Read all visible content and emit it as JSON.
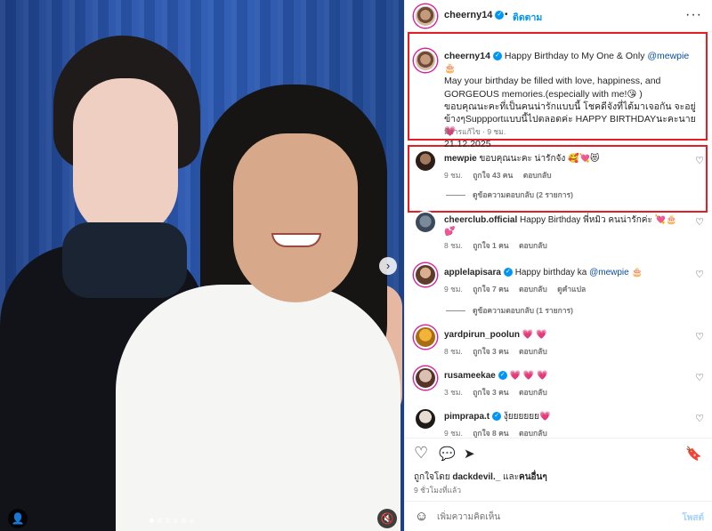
{
  "photo": {
    "next_icon": "›",
    "tag_icon": "👤",
    "mute_icon": "🔇",
    "carousel_dots": 6,
    "active_dot": 0
  },
  "header": {
    "username": "cheerny14",
    "separator": "•",
    "follow_label": "ติดตาม",
    "more_icon": "···"
  },
  "caption": {
    "username": "cheerny14",
    "line1_prefix": "Happy Birthday to My One & Only ",
    "mention": "@mewpie",
    "line1_suffix": " 🎂",
    "line2": "May your birthday be filled with love, happiness, and GORGEOUS memories.(especially with me!😘 )",
    "line3": "ขอบคุณนะคะที่เป็นคนน่ารักแบบนี้ โชคดีจังที่ได้มาเจอกัน จะอยู่ข้างๆSuppportแบบนี้ไปตลอดค่ะ HAPPY BIRTHDAYนะคะนาย💗",
    "line4": "21.12.2025",
    "meta": "มีการแก้ไข · 9 ชม."
  },
  "comments": [
    {
      "username": "mewpie",
      "verified": false,
      "text": "ขอบคุณนะคะ น่ารักจัง 🥰💘😻",
      "time": "9 ชม.",
      "likes": "ถูกใจ 43 คน",
      "reply": "ตอบกลับ",
      "translate": "",
      "replies_label": "ดูข้อความตอบกลับ (2 รายการ)"
    },
    {
      "username": "cheerclub.official",
      "verified": false,
      "text": "Happy Birthday พี่หมิว คนน่ารักค่ะ 💘🎂💕",
      "time": "8 ชม.",
      "likes": "ถูกใจ 1 คน",
      "reply": "ตอบกลับ",
      "translate": "",
      "replies_label": ""
    },
    {
      "username": "applelapisara",
      "verified": true,
      "text_prefix": "Happy birthday ka ",
      "mention": "@mewpie",
      "text_suffix": " 🎂",
      "time": "9 ชม.",
      "likes": "ถูกใจ 7 คน",
      "reply": "ตอบกลับ",
      "translate": "ดูคำแปล",
      "replies_label": "ดูข้อความตอบกลับ (1 รายการ)"
    },
    {
      "username": "yardpirun_poolun",
      "verified": false,
      "text": "💗 💗",
      "time": "8 ชม.",
      "likes": "ถูกใจ 3 คน",
      "reply": "ตอบกลับ",
      "translate": "",
      "replies_label": ""
    },
    {
      "username": "rusameekae",
      "verified": true,
      "text": "💗 💗 💗",
      "time": "3 ชม.",
      "likes": "ถูกใจ 3 คน",
      "reply": "ตอบกลับ",
      "translate": "",
      "replies_label": ""
    },
    {
      "username": "pimprapa.t",
      "verified": true,
      "text": "งุ้ยยยยยย💗",
      "time": "9 ชม.",
      "likes": "ถูกใจ 8 คน",
      "reply": "ตอบกลับ",
      "translate": "",
      "replies_label": ""
    }
  ],
  "actions": {
    "like_icon": "♡",
    "comment_icon": "💬",
    "share_icon": "➤",
    "save_icon": "🔖"
  },
  "likes_prefix": "ถูกใจโดย ",
  "likes_user": "dackdevil._",
  "likes_mid": " และ",
  "likes_others": "คนอื่นๆ",
  "time_ago": "9 ชั่วโมงที่แล้ว",
  "composer": {
    "emoji_icon": "☺",
    "placeholder": "เพิ่มความคิดเห็น",
    "post_label": "โพสต์"
  },
  "colors": {
    "link": "#0095f6",
    "highlight_box": "#e31e24",
    "heart": "#ed4956"
  }
}
